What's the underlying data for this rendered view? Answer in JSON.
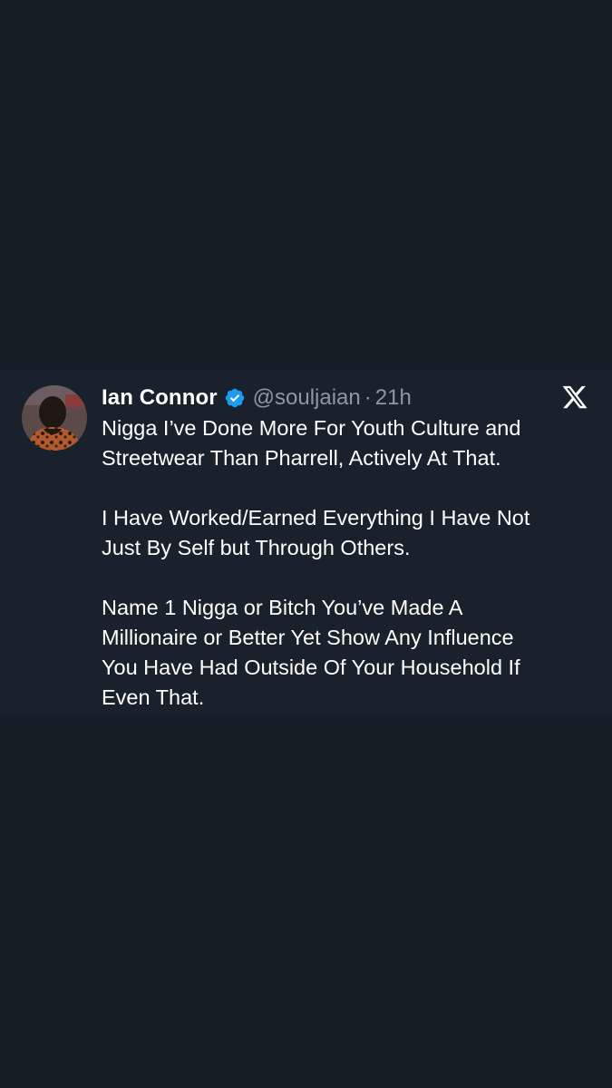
{
  "tweet": {
    "author_name": "Ian Connor",
    "handle": "@souljaian",
    "separator": "·",
    "time": "21h",
    "verified_icon": "verified-badge-icon",
    "platform_icon": "x-logo-icon",
    "colors": {
      "background": "#151d27",
      "card": "#18212c",
      "text": "#ffffff",
      "muted": "#8b98a5",
      "verified": "#1d9bf0"
    },
    "paragraphs": [
      {
        "lines": [
          "Nigga I’ve Done More For Youth Culture and",
          "Streetwear Than Pharrell, Actively At That."
        ]
      },
      {
        "lines": [
          "I Have Worked/Earned Everything I Have Not",
          "Just By Self but Through Others."
        ]
      },
      {
        "lines": [
          "Name 1 Nigga or Bitch You’ve Made A",
          "Millionaire or Better Yet Show Any Influence",
          "You Have Had Outside Of Your Household If",
          "Even That."
        ]
      }
    ]
  }
}
